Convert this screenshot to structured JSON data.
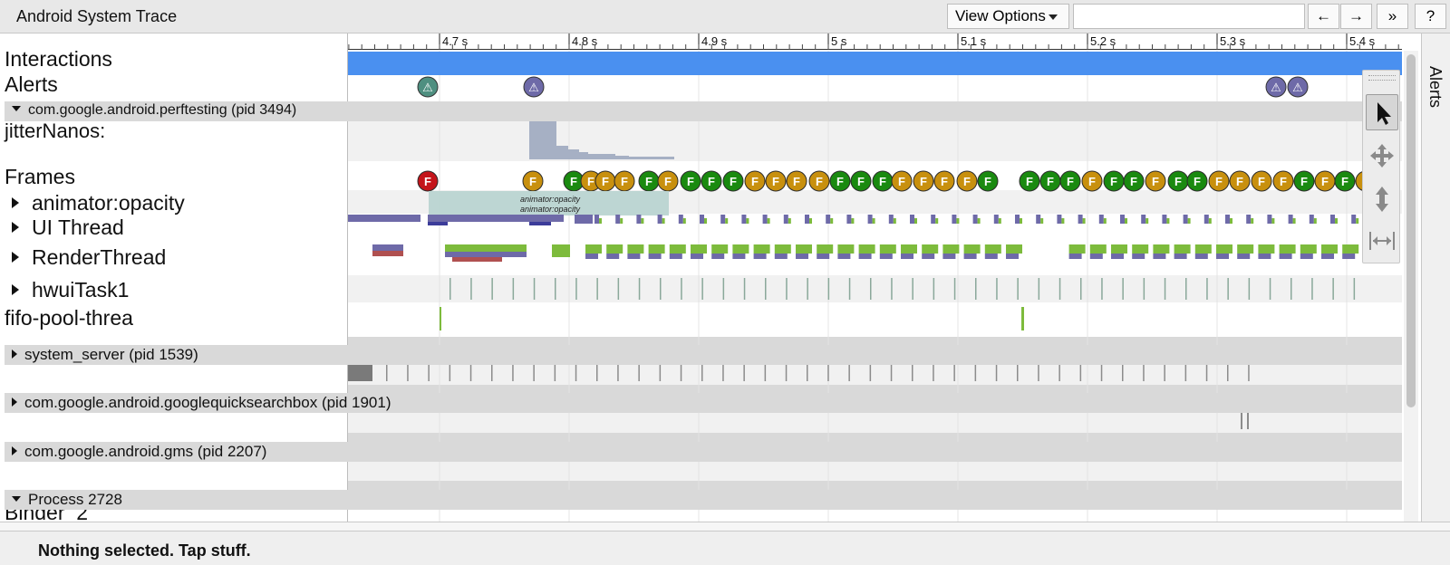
{
  "toolbar": {
    "title": "Android System Trace",
    "view_options_label": "View Options",
    "search_value": "",
    "prev_label": "←",
    "next_label": "→",
    "more_label": "»",
    "help_label": "?"
  },
  "ruler": {
    "ticks": [
      "4.7 s",
      "4.8 s",
      "4.9 s",
      "5 s",
      "5.1 s",
      "5.2 s",
      "5.3 s",
      "5.4 s"
    ]
  },
  "tracks": {
    "interactions": "Interactions",
    "alerts": "Alerts",
    "jitter": "jitterNanos:",
    "frames": "Frames",
    "animator": "animator:opacity",
    "ui_thread": "UI Thread",
    "render_thread": "RenderThread",
    "hwui": "hwuiTask1",
    "fifo": "fifo-pool-threa",
    "binder": "Binder_2"
  },
  "slices": {
    "animator_1": "animator:opacity",
    "animator_2": "animator:opacity"
  },
  "processes": {
    "perftesting": "com.google.android.perftesting (pid 3494)",
    "system_server": "system_server (pid 1539)",
    "gsa": "com.google.android.googlequicksearchbox (pid 1901)",
    "gms": "com.google.android.gms (pid 2207)",
    "p2728": "Process 2728"
  },
  "frames": {
    "marker_label": "F",
    "colors": {
      "red": "#c4141a",
      "orange": "#c8900e",
      "green": "#1a8a10"
    }
  },
  "alert_glyph": "⚠",
  "side_panel": {
    "label": "Alerts"
  },
  "status": {
    "text": "Nothing selected. Tap stuff."
  },
  "colors": {
    "interaction_bar": "#4a90f0",
    "render_green": "#7dbb3c",
    "thread_purple": "#6e6aa8",
    "slice_teal": "#b7d3cf",
    "jitter_gray": "#a6b0c4"
  }
}
